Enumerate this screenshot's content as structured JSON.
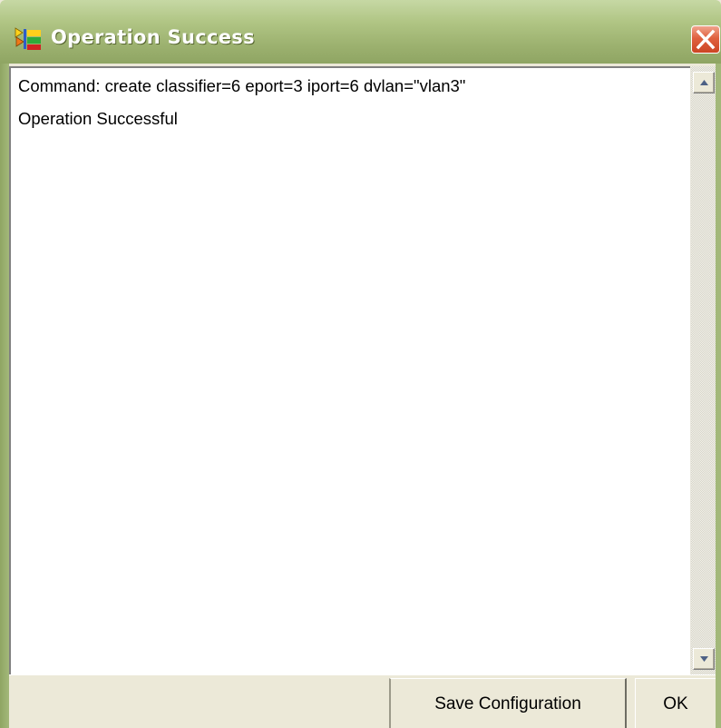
{
  "window": {
    "title": "Operation Success",
    "icons": {
      "app": "app-icon",
      "close": "close-icon"
    },
    "colors": {
      "titlebar": "#9db270",
      "close": "#e0613f",
      "face": "#ece9d8"
    }
  },
  "output": {
    "lines": [
      "Command: create classifier=6 eport=3 iport=6 dvlan=\"vlan3\"",
      "Operation Successful"
    ]
  },
  "scrollbar": {
    "up_icon": "arrow-up-icon",
    "down_icon": "arrow-down-icon"
  },
  "buttons": {
    "save_label": "Save Configuration",
    "ok_label": "OK"
  }
}
